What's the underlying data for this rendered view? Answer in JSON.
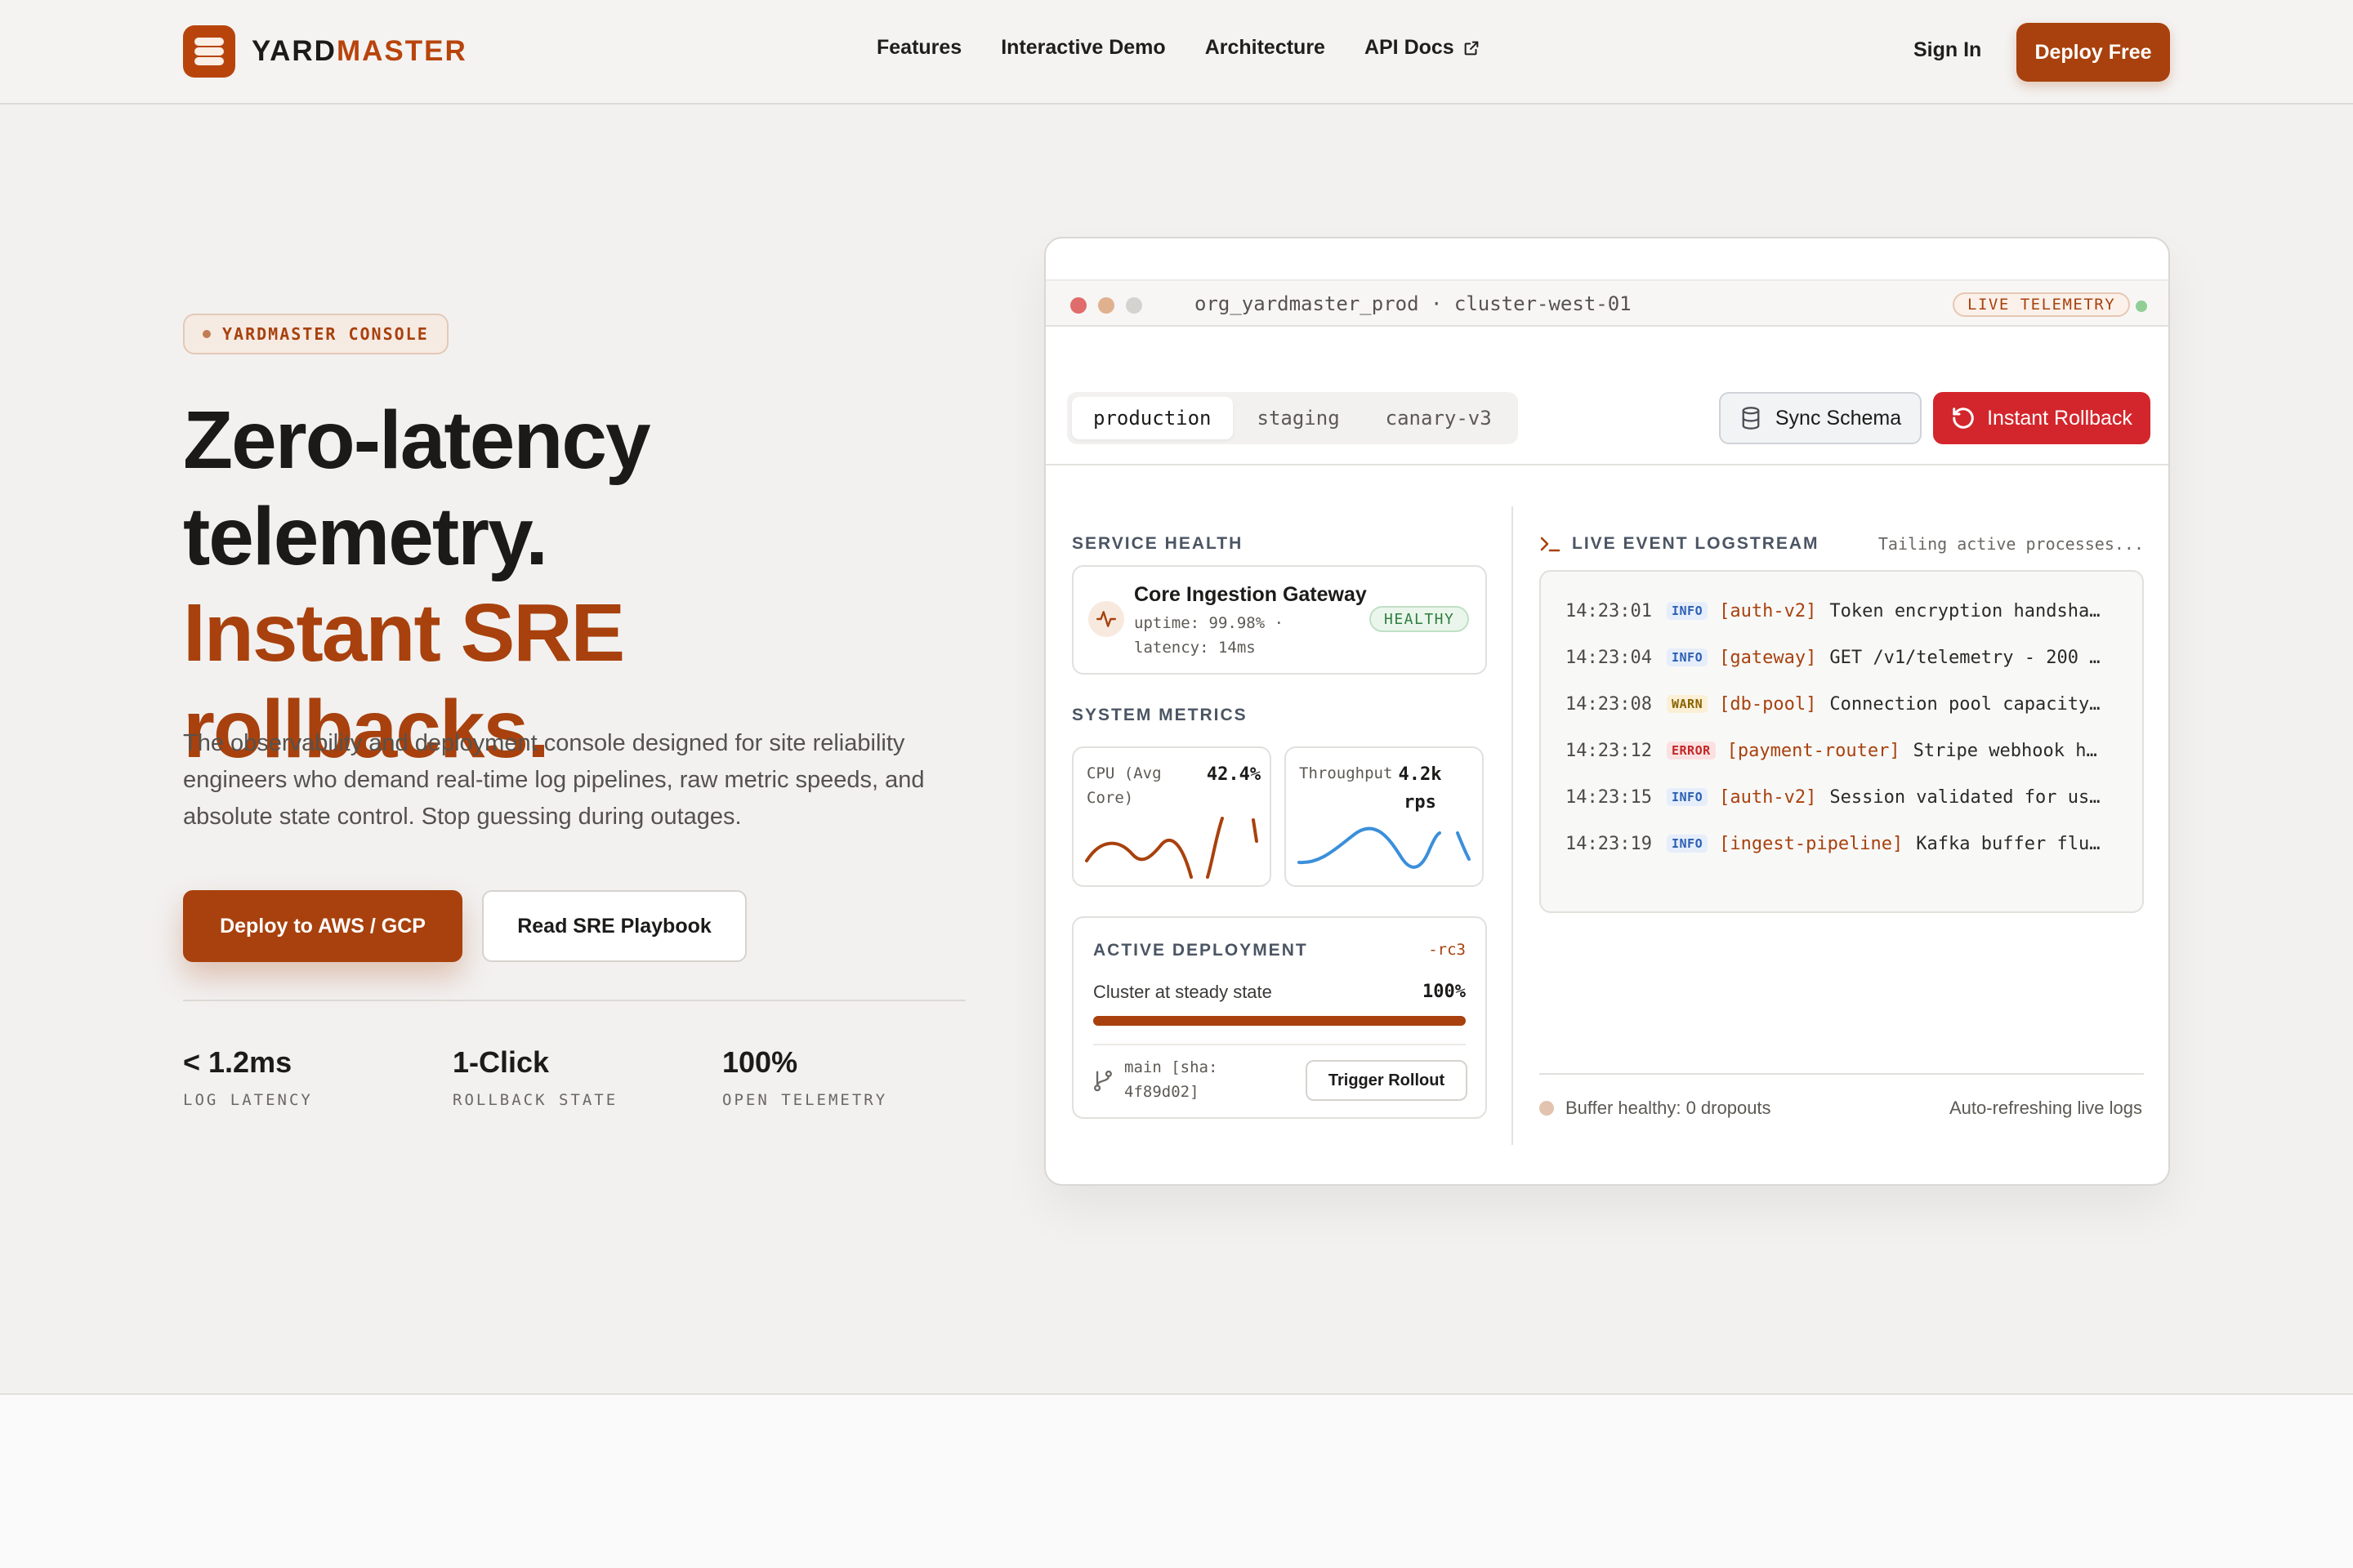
{
  "brand": {
    "name_part1": "YARD",
    "name_part2": "MASTER",
    "icon": "stack-logo-icon",
    "accent_color": "#a8410d"
  },
  "nav": {
    "links": [
      {
        "label": "Features"
      },
      {
        "label": "Interactive Demo"
      },
      {
        "label": "Architecture"
      },
      {
        "label": "API Docs",
        "icon": "external-link-icon"
      }
    ],
    "signin": "Sign In",
    "cta": "Deploy Free"
  },
  "hero": {
    "badge": "YARDMASTER CONSOLE",
    "title_line1": "Zero-latency",
    "title_line2": "telemetry.",
    "title_accent": "Instant SRE rollbacks.",
    "lede": "The observability and deployment console designed for site reliability engineers who demand real-time log pipelines, raw metric speeds, and absolute state control. Stop guessing during outages.",
    "primary_cta": "Deploy to AWS / GCP",
    "secondary_cta": "Read SRE Playbook",
    "stats": [
      {
        "value": "< 1.2ms",
        "label": "LOG LATENCY"
      },
      {
        "value": "1-Click",
        "label": "ROLLBACK STATE"
      },
      {
        "value": "100%",
        "label": "OPEN TELEMETRY"
      }
    ]
  },
  "console": {
    "path": "org_yardmaster_prod · cluster-west-01",
    "live_tag": "LIVE TELEMETRY",
    "window_dot_colors": [
      "#e06c6c",
      "#e0b18f",
      "#d5d3d0"
    ],
    "env_tabs": [
      {
        "label": "production",
        "active": true
      },
      {
        "label": "staging",
        "active": false
      },
      {
        "label": "canary-v3",
        "active": false
      }
    ],
    "sync_button": "Sync Schema",
    "rollback_button": "Instant Rollback",
    "service_health": {
      "title": "SERVICE HEALTH",
      "name": "Core Ingestion Gateway",
      "meta": "uptime: 99.98% · latency: 14ms",
      "status": "HEALTHY"
    },
    "system_metrics": {
      "title": "SYSTEM METRICS",
      "cpu": {
        "label": "CPU (Avg Core)",
        "value": "42.4%",
        "color": "#a8410d"
      },
      "throughput": {
        "label": "Throughput",
        "value": "4.2k rps",
        "color": "#3b8fdb"
      }
    },
    "deployment": {
      "title": "ACTIVE DEPLOYMENT",
      "tag": "-rc3",
      "status": "Cluster at steady state",
      "percent_label": "100%",
      "progress": 1.0,
      "branch": "main [sha: 4f89d02]",
      "trigger": "Trigger Rollout"
    },
    "logstream": {
      "title": "LIVE EVENT LOGSTREAM",
      "subtitle": "Tailing active processes...",
      "rows": [
        {
          "time": "14:23:01",
          "level": "INFO",
          "source": "[auth-v2]",
          "message": "Token encryption handsha…"
        },
        {
          "time": "14:23:04",
          "level": "INFO",
          "source": "[gateway]",
          "message": "GET /v1/telemetry - 200 …"
        },
        {
          "time": "14:23:08",
          "level": "WARN",
          "source": "[db-pool]",
          "message": "Connection pool capacity…"
        },
        {
          "time": "14:23:12",
          "level": "ERROR",
          "source": "[payment-router]",
          "message": "Stripe webhook h…"
        },
        {
          "time": "14:23:15",
          "level": "INFO",
          "source": "[auth-v2]",
          "message": "Session validated for us…"
        },
        {
          "time": "14:23:19",
          "level": "INFO",
          "source": "[ingest-pipeline]",
          "message": "Kafka buffer flu…"
        }
      ],
      "buffer": "Buffer healthy: 0 dropouts",
      "autorefresh": "Auto-refreshing live logs"
    }
  }
}
